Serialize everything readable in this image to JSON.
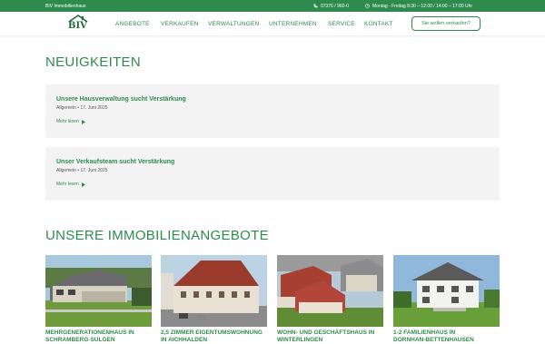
{
  "topbar": {
    "brand": "BIV Immobilienhaus",
    "phone": "07376 / 960-0",
    "hours": "Montag - Freitag 8:30 – 12:00 / 14:00 – 17:00 Uhr",
    "phone_icon": "phone-icon",
    "clock_icon": "clock-icon"
  },
  "header": {
    "logo_text": "BIV",
    "nav": [
      "ANGEBOTE",
      "VERKAUFEN",
      "VERWALTUNGEN",
      "UNTERNEHMEN",
      "SERVICE",
      "KONTAKT"
    ],
    "cta_label": "Sie wollen verkaufen?"
  },
  "news": {
    "heading": "NEUIGKEITEN",
    "items": [
      {
        "title": "Unsere Hausverwaltung sucht Verstärkung",
        "meta": "Allgemein • 17. Juni 2025",
        "more": "Mehr lesen"
      },
      {
        "title": "Unser Verkaufsteam sucht Verstärkung",
        "meta": "Allgemein • 17. Juni 2025",
        "more": "Mehr lesen"
      }
    ]
  },
  "offers": {
    "heading": "UNSERE IMMOBILIENANGEBOTE",
    "cards": [
      {
        "label": "MEHRGENERATIONENHAUS IN",
        "label2": "SCHRAMBERG-SULGEN"
      },
      {
        "label": "2,5 ZIMMER EIGENTUMSWOHNUNG",
        "label2": "IN AICHHALDEN"
      },
      {
        "label": "WOHN- UND GESCHÄFTSHAUS IN",
        "label2": "WINTERLINGEN"
      },
      {
        "label": "1-2 FAMILIENHAUS IN",
        "label2": "DORNHAN-BETTENHAUSEN"
      }
    ]
  },
  "colors": {
    "brand_green": "#2e8b4e",
    "card_bg": "#f3f3f3"
  }
}
